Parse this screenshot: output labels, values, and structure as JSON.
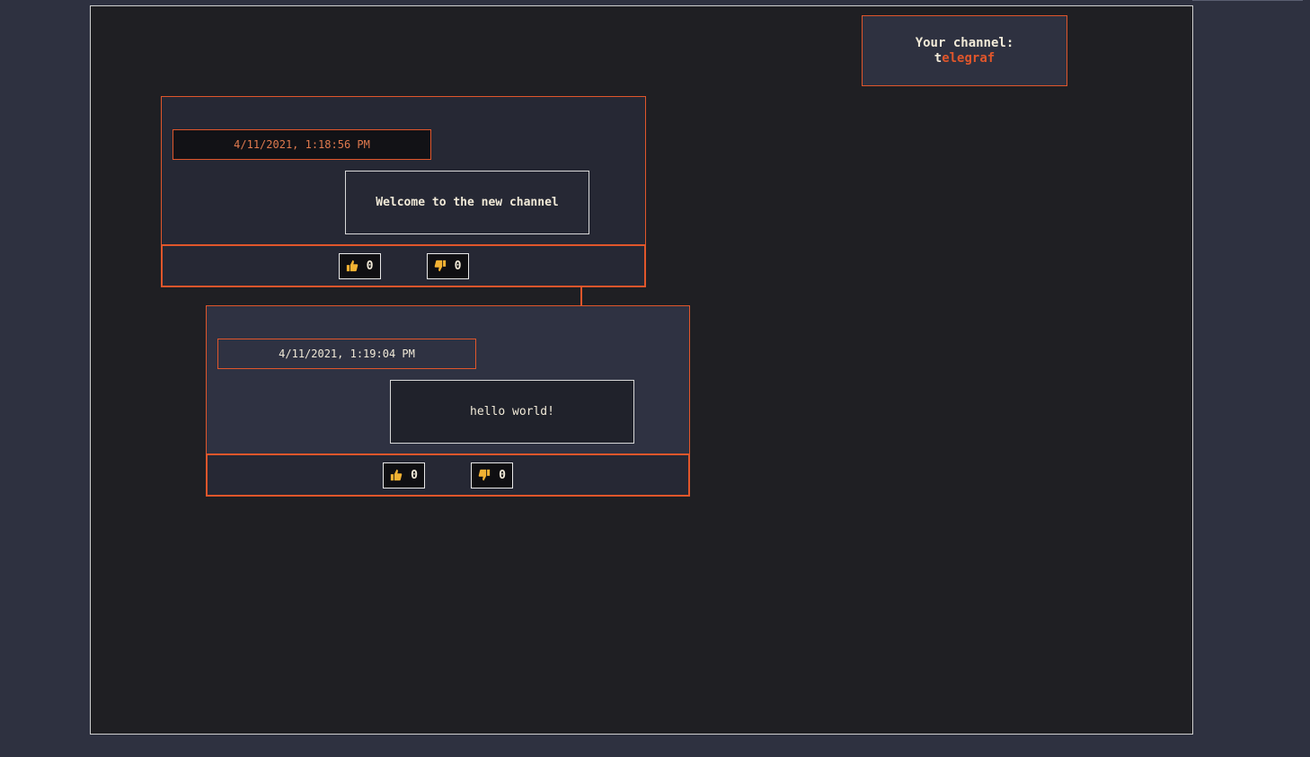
{
  "channel": {
    "label": "Your channel:",
    "name_first": "t",
    "name_rest": "elegraf"
  },
  "messages": [
    {
      "timestamp": "4/11/2021, 1:18:56 PM",
      "text": "Welcome to the new channel",
      "likes": "0",
      "dislikes": "0"
    },
    {
      "timestamp": "4/11/2021, 1:19:04 PM",
      "text": "hello world!",
      "likes": "0",
      "dislikes": "0"
    }
  ],
  "icons": {
    "like": "thumbs-up-icon",
    "dislike": "thumbs-down-icon"
  },
  "colors": {
    "accent": "#e0562b",
    "icon": "#f2b233",
    "background": "#1f1f23",
    "page": "#2e3140"
  }
}
